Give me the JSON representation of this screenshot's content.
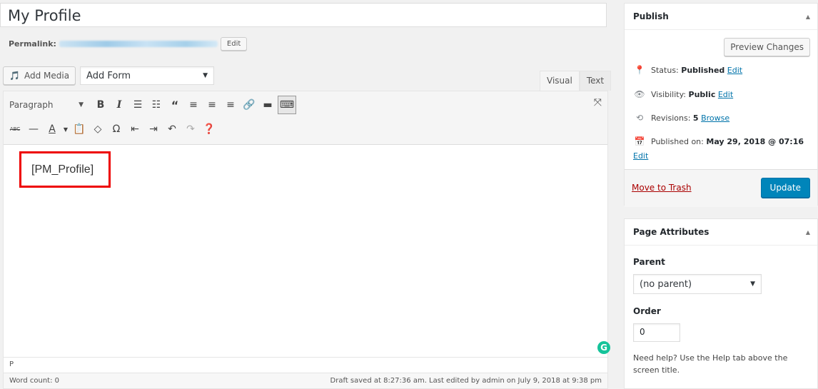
{
  "post": {
    "title": "My Profile"
  },
  "permalink": {
    "label": "Permalink:",
    "edit_label": "Edit"
  },
  "media": {
    "add_media_label": "Add Media",
    "add_form_selected": "Add Form"
  },
  "editor_tabs": [
    "Visual",
    "Text"
  ],
  "toolbar": {
    "format_selected": "Paragraph",
    "row1_icons": [
      "bold-icon",
      "italic-icon",
      "bulleted-list-icon",
      "numbered-list-icon",
      "blockquote-icon",
      "align-left-icon",
      "align-center-icon",
      "align-right-icon",
      "link-icon",
      "read-more-icon",
      "toolbar-toggle-icon"
    ],
    "row2_icons": [
      "strikethrough-icon",
      "horizontal-line-icon",
      "text-color-icon",
      "paste-as-text-icon",
      "clear-formatting-icon",
      "special-character-icon",
      "outdent-icon",
      "indent-icon",
      "undo-icon",
      "redo-icon",
      "help-icon"
    ]
  },
  "content": {
    "shortcode": "[PM_Profile]",
    "highlight_color": "#e00000"
  },
  "status": {
    "path": "P",
    "word_count": "Word count: 0",
    "draft_saved": "Draft saved at 8:27:36 am. Last edited by admin on July 9, 2018 at 9:38 pm"
  },
  "publish": {
    "title": "Publish",
    "preview_label": "Preview Changes",
    "status_label": "Status:",
    "status_value": "Published",
    "status_edit": "Edit",
    "visibility_label": "Visibility:",
    "visibility_value": "Public",
    "visibility_edit": "Edit",
    "revisions_label": "Revisions:",
    "revisions_value": "5",
    "revisions_link": "Browse",
    "published_label": "Published on:",
    "published_value": "May 29, 2018 @ 07:16",
    "published_edit": "Edit",
    "trash_label": "Move to Trash",
    "update_label": "Update",
    "accent_color": "#0085ba"
  },
  "page_attributes": {
    "title": "Page Attributes",
    "parent_label": "Parent",
    "parent_selected": "(no parent)",
    "order_label": "Order",
    "order_value": "0",
    "help_text": "Need help? Use the Help tab above the screen title."
  }
}
